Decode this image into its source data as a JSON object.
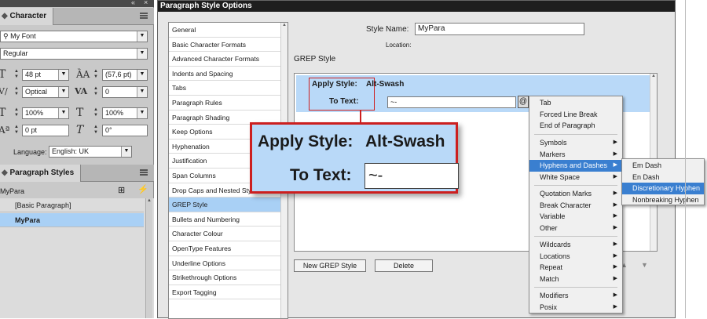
{
  "character_panel": {
    "tab": "Character",
    "font_family": "My Font",
    "font_style": "Regular",
    "font_size": "48 pt",
    "leading": "(57,6 pt)",
    "kerning": "Optical",
    "tracking": "0",
    "vertical_scale": "100%",
    "horizontal_scale": "100%",
    "baseline_shift": "0 pt",
    "skew": "0°",
    "language_label": "Language:",
    "language": "English: UK"
  },
  "paragraph_styles_panel": {
    "tab": "Paragraph Styles",
    "current_style": "MyPara",
    "styles": [
      "[Basic Paragraph]",
      "MyPara"
    ]
  },
  "dialog": {
    "title": "Paragraph Style Options",
    "style_name_label": "Style Name:",
    "style_name": "MyPara",
    "location_label": "Location:",
    "section_heading": "GREP Style",
    "categories": [
      "General",
      "Basic Character Formats",
      "Advanced Character Formats",
      "Indents and Spacing",
      "Tabs",
      "Paragraph Rules",
      "Paragraph Shading",
      "Keep Options",
      "Hyphenation",
      "Justification",
      "Span Columns",
      "Drop Caps and Nested Styles",
      "GREP Style",
      "Bullets and Numbering",
      "Character Colour",
      "OpenType Features",
      "Underline Options",
      "Strikethrough Options",
      "Export Tagging"
    ],
    "selected_category": "GREP Style",
    "grep": {
      "apply_style_label": "Apply Style:",
      "apply_style_value": "Alt-Swash",
      "to_text_label": "To Text:",
      "to_text_value": "~-",
      "special_char_symbol": "@"
    },
    "new_grep_button": "New GREP Style",
    "delete_button": "Delete"
  },
  "context_menu": {
    "items": [
      "Tab",
      "Forced Line Break",
      "End of Paragraph",
      "Symbols",
      "Markers",
      "Hyphens and Dashes",
      "White Space",
      "Quotation Marks",
      "Break Character",
      "Variable",
      "Other",
      "Wildcards",
      "Locations",
      "Repeat",
      "Match",
      "Modifiers",
      "Posix"
    ],
    "highlighted": "Hyphens and Dashes"
  },
  "submenu": {
    "items": [
      "Em Dash",
      "En Dash",
      "Discretionary Hyphen",
      "Nonbreaking Hyphen"
    ],
    "highlighted": "Discretionary Hyphen"
  },
  "zoom_callout": {
    "apply_style_label": "Apply Style:",
    "apply_style_value": "Alt-Swash",
    "to_text_label": "To Text:",
    "to_text_value": "~-"
  },
  "colors": {
    "highlight_row": "#b9d9f8",
    "menu_highlight": "#3a7fd0",
    "callout_border": "#cc1f1f"
  }
}
